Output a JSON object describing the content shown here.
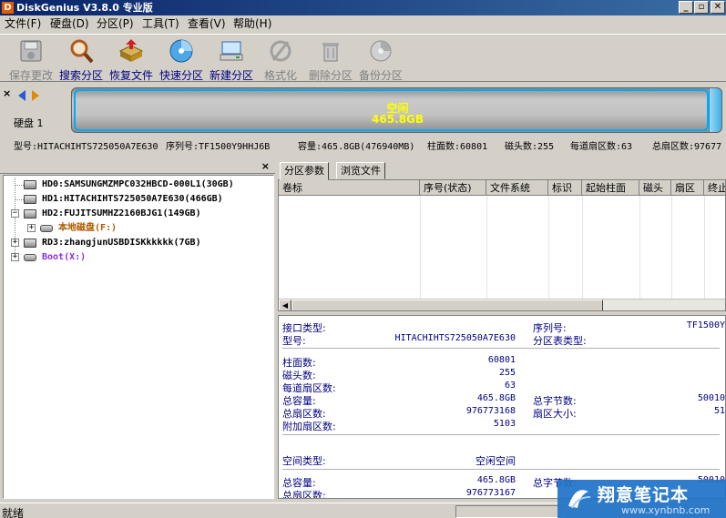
{
  "window": {
    "title": "DiskGenius V3.8.0 专业版",
    "app_icon": "D",
    "minimize": "_",
    "restore": "▫",
    "close": "✕"
  },
  "menu": [
    "文件(F)",
    "硬盘(D)",
    "分区(P)",
    "工具(T)",
    "查看(V)",
    "帮助(H)"
  ],
  "toolbar": [
    {
      "label": "保存更改",
      "icon": "save-disk-icon",
      "enabled": false
    },
    {
      "label": "搜索分区",
      "icon": "magnifier-icon",
      "enabled": true
    },
    {
      "label": "恢复文件",
      "icon": "recover-file-icon",
      "enabled": true
    },
    {
      "label": "快速分区",
      "icon": "quick-partition-icon",
      "enabled": true
    },
    {
      "label": "新建分区",
      "icon": "new-partition-icon",
      "enabled": true
    },
    {
      "label": "格式化",
      "icon": "format-icon",
      "enabled": false
    },
    {
      "label": "删除分区",
      "icon": "delete-partition-icon",
      "enabled": false
    },
    {
      "label": "备份分区",
      "icon": "backup-partition-icon",
      "enabled": false
    }
  ],
  "diskbar": {
    "close": "×",
    "disk_label": "硬盘 1",
    "partition_name": "空闲",
    "partition_size": "465.8GB",
    "accent": "#00aaff",
    "text_color": "#ffff00"
  },
  "diskinfo": [
    "型号:HITACHIHTS725050A7E630",
    "序列号:TF1500Y9HHJ6B",
    "容量:465.8GB(476940MB)",
    "柱面数:60801",
    "磁头数:255",
    "每道扇区数:63",
    "总扇区数:97677"
  ],
  "tree": {
    "close": "×",
    "nodes": [
      {
        "label": "HD0:SAMSUNGMZMPC032HBCD-000L1(30GB)",
        "type": "disk",
        "expander": ""
      },
      {
        "label": "HD1:HITACHIHTS725050A7E630(466GB)",
        "type": "disk",
        "expander": "",
        "selected": true
      },
      {
        "label": "HD2:FUJITSUMHZ2160BJG1(149GB)",
        "type": "disk",
        "expander": "−"
      },
      {
        "label": "本地磁盘(F:)",
        "type": "volume",
        "expander": "+",
        "color": "#b05a00"
      },
      {
        "label": "RD3:zhangjunUSBDISKkkkkk(7GB)",
        "type": "disk",
        "expander": "+"
      },
      {
        "label": "Boot(X:)",
        "type": "volume",
        "expander": "+",
        "color": "#8a2be2"
      }
    ]
  },
  "tabs": [
    "分区参数",
    "浏览文件"
  ],
  "grid": {
    "columns": [
      "卷标",
      "序号(状态)",
      "文件系统",
      "标识",
      "起始柱面",
      "磁头",
      "扇区",
      "终止"
    ],
    "scroll_left": "◀"
  },
  "details": {
    "interface_label": "接口类型:",
    "interface_value": "",
    "serial_label": "序列号:",
    "serial_value": "TF1500Y",
    "model_label": "型号:",
    "model_value": "HITACHIHTS725050A7E630",
    "table_type_label": "分区表类型:",
    "cylinders_label": "柱面数:",
    "cylinders_value": "60801",
    "heads_label": "磁头数:",
    "heads_value": "255",
    "spt_label": "每道扇区数:",
    "spt_value": "63",
    "capacity_label": "总容量:",
    "capacity_value": "465.8GB",
    "total_bytes_label": "总字节数:",
    "total_bytes_value": "50010",
    "total_sectors_label": "总扇区数:",
    "total_sectors_value": "976773168",
    "sector_size_label": "扇区大小:",
    "sector_size_value": "51",
    "extra_sectors_label": "附加扇区数:",
    "extra_sectors_value": "5103",
    "space_type_label": "空间类型:",
    "space_type_value": "空闲空间",
    "space_capacity_label": "总容量:",
    "space_capacity_value": "465.8GB",
    "space_bytes_label": "总字节数:",
    "space_bytes_value": "50010",
    "space_sectors_label": "总扇区数:",
    "space_sectors_value": "976773167"
  },
  "status": {
    "text": "就绪"
  },
  "watermark": {
    "title": "翔意笔记本",
    "url": "www.xynbnb.com"
  }
}
